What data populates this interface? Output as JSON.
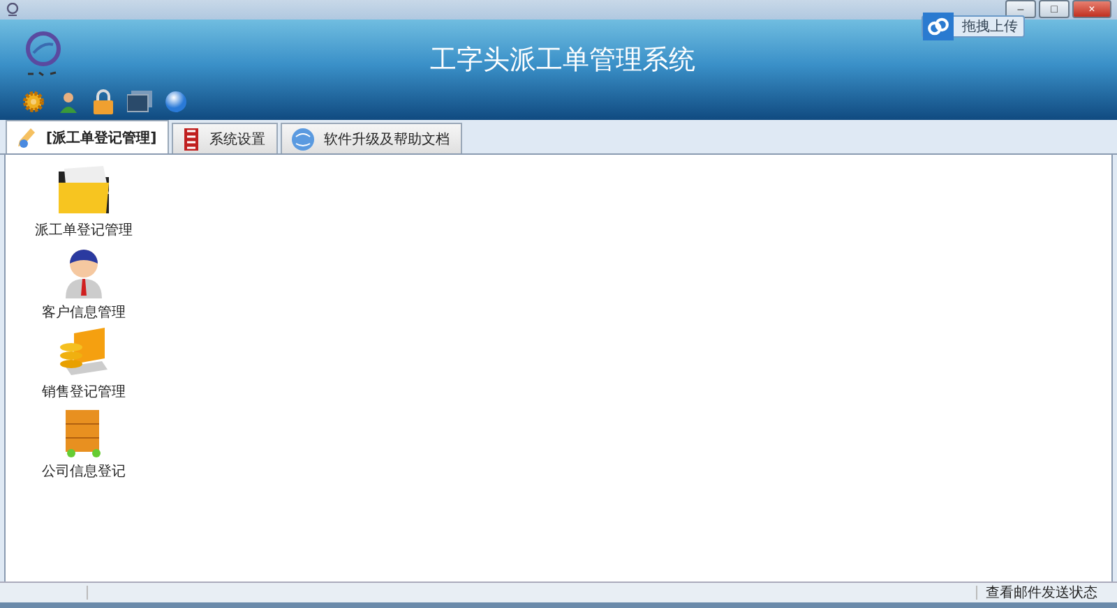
{
  "window": {
    "title_buttons": [
      "–",
      "□",
      "×"
    ]
  },
  "header": {
    "title": "工字头派工单管理系统",
    "upload_button": "拖拽上传"
  },
  "tabs": [
    {
      "label": "[派工单登记管理]",
      "selected": true
    },
    {
      "label": "系统设置",
      "selected": false
    },
    {
      "label": "软件升级及帮助文档",
      "selected": false
    }
  ],
  "launchers": [
    {
      "label": "派工单登记管理"
    },
    {
      "label": "客户信息管理"
    },
    {
      "label": "销售登记管理"
    },
    {
      "label": "公司信息登记"
    }
  ],
  "status_bar": {
    "text": "查看邮件发送状态"
  }
}
